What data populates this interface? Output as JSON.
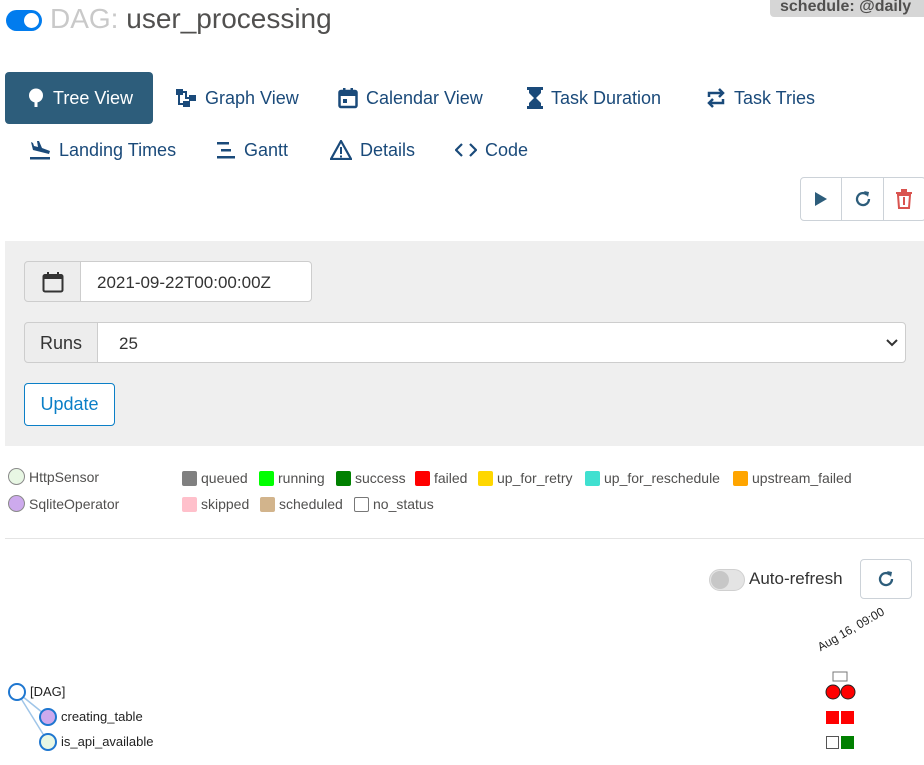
{
  "header": {
    "title_prefix": "DAG:",
    "dag_id": "user_processing",
    "schedule": "schedule: @daily"
  },
  "nav": {
    "tabs": [
      {
        "label": "Tree View",
        "icon": "tree-icon",
        "active": true
      },
      {
        "label": "Graph View",
        "icon": "graph-icon"
      },
      {
        "label": "Calendar View",
        "icon": "calendar-icon"
      },
      {
        "label": "Task Duration",
        "icon": "hourglass-icon"
      },
      {
        "label": "Task Tries",
        "icon": "repeat-icon"
      },
      {
        "label": "Landing Times",
        "icon": "plane-landing-icon"
      },
      {
        "label": "Gantt",
        "icon": "gantt-icon"
      },
      {
        "label": "Details",
        "icon": "warning-triangle-icon"
      },
      {
        "label": "Code",
        "icon": "code-icon"
      }
    ]
  },
  "actions": {
    "trigger_icon": "play-icon",
    "refresh_icon": "refresh-icon",
    "delete_icon": "trash-icon",
    "delete_color": "#d9534f"
  },
  "filters": {
    "date_value": "2021-09-22T00:00:00Z",
    "runs_label": "Runs",
    "runs_value": "25",
    "update_label": "Update"
  },
  "operators": [
    {
      "name": "HttpSensor",
      "color": "#e8f7e4"
    },
    {
      "name": "SqliteOperator",
      "color": "#cdaaed"
    }
  ],
  "states": [
    {
      "name": "queued",
      "color": "#808080"
    },
    {
      "name": "running",
      "color": "#00ff00"
    },
    {
      "name": "success",
      "color": "#008000"
    },
    {
      "name": "failed",
      "color": "#ff0000"
    },
    {
      "name": "up_for_retry",
      "color": "#ffd700"
    },
    {
      "name": "up_for_reschedule",
      "color": "#40e0d0"
    },
    {
      "name": "upstream_failed",
      "color": "#ffa500"
    },
    {
      "name": "skipped",
      "color": "#ffc0cb"
    },
    {
      "name": "scheduled",
      "color": "#d2b48c"
    },
    {
      "name": "no_status",
      "color": "#ffffff"
    }
  ],
  "tree": {
    "auto_refresh_label": "Auto-refresh",
    "auto_refresh_on": false,
    "run_date": "Aug 16, 09:00",
    "nodes": [
      {
        "label": "[DAG]",
        "runs": [
          "failed",
          "failed"
        ]
      },
      {
        "label": "creating_table",
        "runs": [
          "failed",
          "failed"
        ]
      },
      {
        "label": "is_api_available",
        "runs": [
          "no_status",
          "success"
        ]
      }
    ]
  }
}
